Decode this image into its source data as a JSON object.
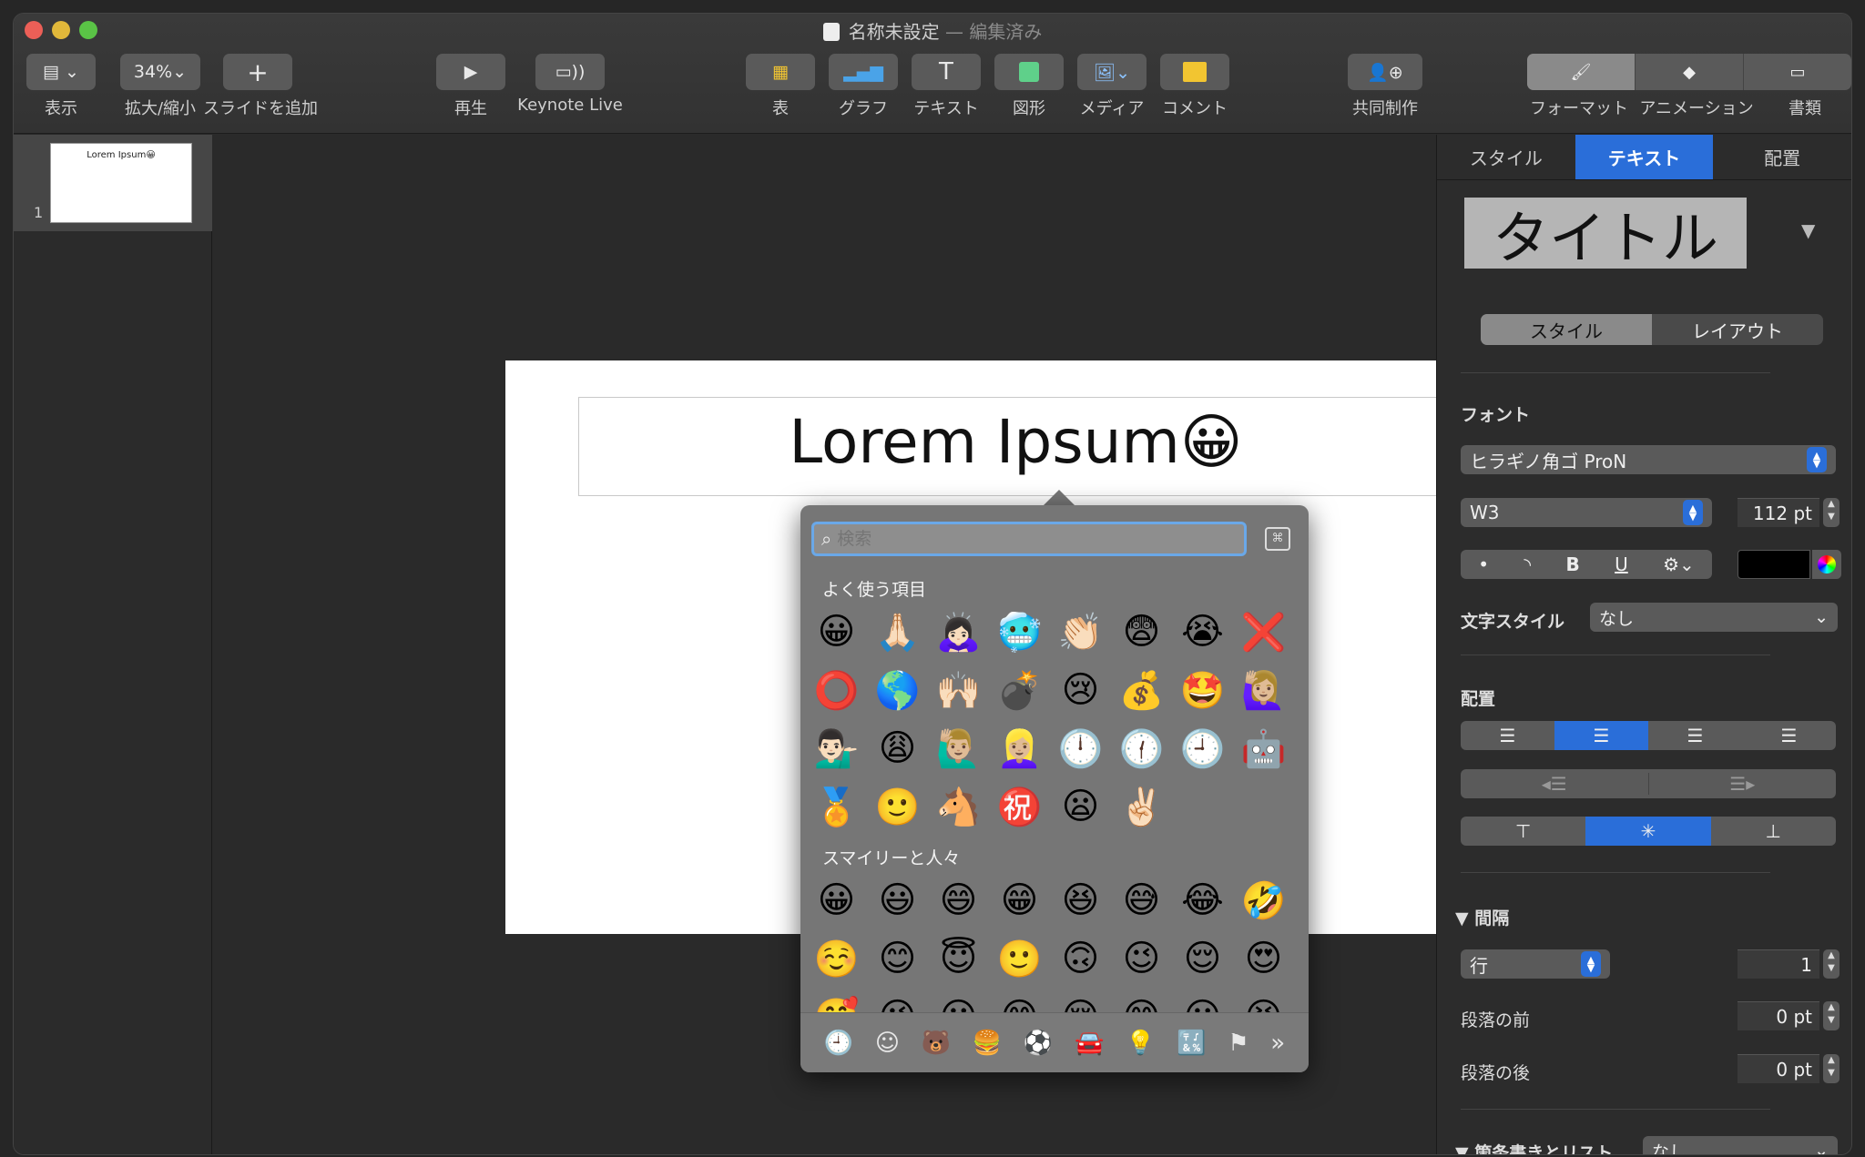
{
  "window": {
    "title": "名称未設定",
    "title_suffix": "— 編集済み"
  },
  "toolbar": {
    "view": "表示",
    "zoom_value": "34%",
    "zoom": "拡大/縮小",
    "add_slide": "スライドを追加",
    "play": "再生",
    "keynote_live": "Keynote Live",
    "table": "表",
    "chart": "グラフ",
    "text": "テキスト",
    "shape": "図形",
    "media": "メディア",
    "comment": "コメント",
    "collaborate": "共同制作",
    "format": "フォーマット",
    "animate": "アニメーション",
    "document": "書類"
  },
  "sidebar": {
    "slide_number": "1",
    "thumb_text": "Lorem Ipsum😀"
  },
  "slide": {
    "title": "Lorem Ipsum😀"
  },
  "picker": {
    "search_placeholder": "検索",
    "frequent_header": "よく使う項目",
    "smileys_header": "スマイリーと人々",
    "frequent": [
      "😀",
      "🙏🏻",
      "🙇🏻‍♀️",
      "🥶",
      "👏🏻",
      "😨",
      "😭",
      "❌",
      "⭕",
      "🌎",
      "🙌🏻",
      "💣",
      "😢",
      "💰",
      "🤩",
      "🙋🏼‍♀️",
      "💁🏻‍♂️",
      "😩",
      "🙋🏼‍♂️",
      "👱🏼‍♀️",
      "🕛",
      "🕧",
      "🕘",
      "🤖",
      "🏅",
      "🙂",
      "🐴",
      "㊗️",
      "😦",
      "✌🏻"
    ],
    "smileys": [
      "😀",
      "😃",
      "😄",
      "😁",
      "😆",
      "😅",
      "😂",
      "🤣",
      "☺️",
      "😊",
      "😇",
      "🙂",
      "🙃",
      "😉",
      "😌",
      "😍",
      "🥰",
      "😘",
      "😗",
      "😙",
      "😚",
      "😋",
      "😛",
      "😝"
    ],
    "categories": [
      "🕘",
      "☺",
      "🐻",
      "🍔",
      "⚽",
      "🚘",
      "💡",
      "🔣",
      "⚑",
      "»"
    ]
  },
  "inspector": {
    "tabs": [
      "スタイル",
      "テキスト",
      "配置"
    ],
    "style_preview": "タイトル",
    "subtabs": [
      "スタイル",
      "レイアウト"
    ],
    "font_label": "フォント",
    "font_family": "ヒラギノ角ゴ ProN",
    "font_weight": "W3",
    "font_size": "112 pt",
    "bold": "B",
    "underline": "U",
    "char_style_label": "文字スタイル",
    "char_style_value": "なし",
    "alignment_label": "配置",
    "spacing_label": "間隔",
    "line_label": "行",
    "line_value": "1",
    "before_label": "段落の前",
    "before_value": "0 pt",
    "after_label": "段落の後",
    "after_value": "0 pt",
    "bullets_label": "箇条書きとリスト",
    "bullets_value": "なし"
  },
  "colors": {
    "accent": "#2a6ed9",
    "red_light": "#ec5f57",
    "yellow_light": "#e1b83a",
    "green_light": "#5ac346"
  }
}
